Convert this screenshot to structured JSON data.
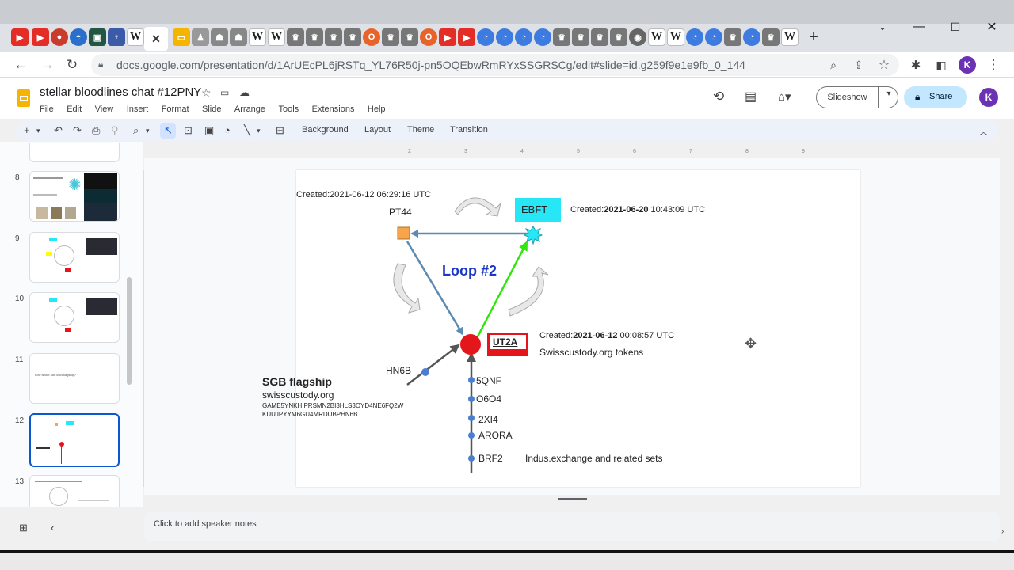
{
  "browser": {
    "url": "docs.google.com/presentation/d/1ArUEcPL6jRSTq_YL76R50j-pn5OQEbwRmRYxSSGRSCg/edit#slide=id.g259f9e1e9fb_0_144",
    "profile_initial": "K"
  },
  "doc": {
    "title": "stellar bloodlines chat #12PNY",
    "menus": [
      "File",
      "Edit",
      "View",
      "Insert",
      "Format",
      "Slide",
      "Arrange",
      "Tools",
      "Extensions",
      "Help"
    ],
    "slideshow_label": "Slideshow",
    "share_label": "Share",
    "profile_initial": "K"
  },
  "toolbar": {
    "background": "Background",
    "layout": "Layout",
    "theme": "Theme",
    "transition": "Transition"
  },
  "filmstrip": {
    "slides": [
      {
        "num": "8"
      },
      {
        "num": "9"
      },
      {
        "num": "10"
      },
      {
        "num": "11"
      },
      {
        "num": "12"
      },
      {
        "num": "13"
      }
    ],
    "slide11_text": "how about our SGB flagship?",
    "selected": "12"
  },
  "slide": {
    "pt44_created": "Created:2021-06-12 06:29:16 UTC",
    "pt44": "PT44",
    "ebft": "EBFT",
    "ebft_created_prefix": "Created:",
    "ebft_created_date": "2021-06-20",
    "ebft_created_time": " 10:43:09 UTC",
    "loop": "Loop #2",
    "ut2a": "UT2A",
    "ut2a_created_prefix": "Created:",
    "ut2a_created_date": "2021-06-12",
    "ut2a_created_time": " 00:08:57 UTC",
    "ut2a_desc": "Swisscustody.org tokens",
    "hn6b": "HN6B",
    "sgb_title": "SGB flagship",
    "sgb_site": "swisscustody.org",
    "sgb_addr1": "GAME5YNKHIPRSMN2BI3HLS3OYD4NE6FQ2W",
    "sgb_addr2": "KUUJPYYM6GU4MRDUBPHN6B",
    "chain": [
      "5QNF",
      "O6O4",
      "2XI4",
      "ARORA",
      "BRF2"
    ],
    "brf2_desc": "Indus.exchange and related sets"
  },
  "notes": {
    "placeholder": "Click to add speaker notes"
  },
  "colors": {
    "accent_blue": "#1a37c8",
    "ut2a_red": "#e3161b",
    "ebft_cyan": "#27e6f5",
    "pt44_orange": "#f7a54b",
    "green_arrow": "#2ee80c"
  }
}
